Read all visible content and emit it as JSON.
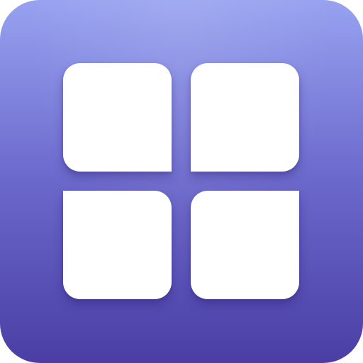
{
  "icon": {
    "name": "grid-app-icon",
    "glyph": "four-tile-grid",
    "colors": {
      "gradient_top": "#97a2f0",
      "gradient_mid": "#6b68cc",
      "gradient_bottom": "#4a3ea4",
      "tile": "#ffffff"
    },
    "tiles": [
      "top-left",
      "top-right",
      "bottom-left",
      "bottom-right"
    ]
  }
}
